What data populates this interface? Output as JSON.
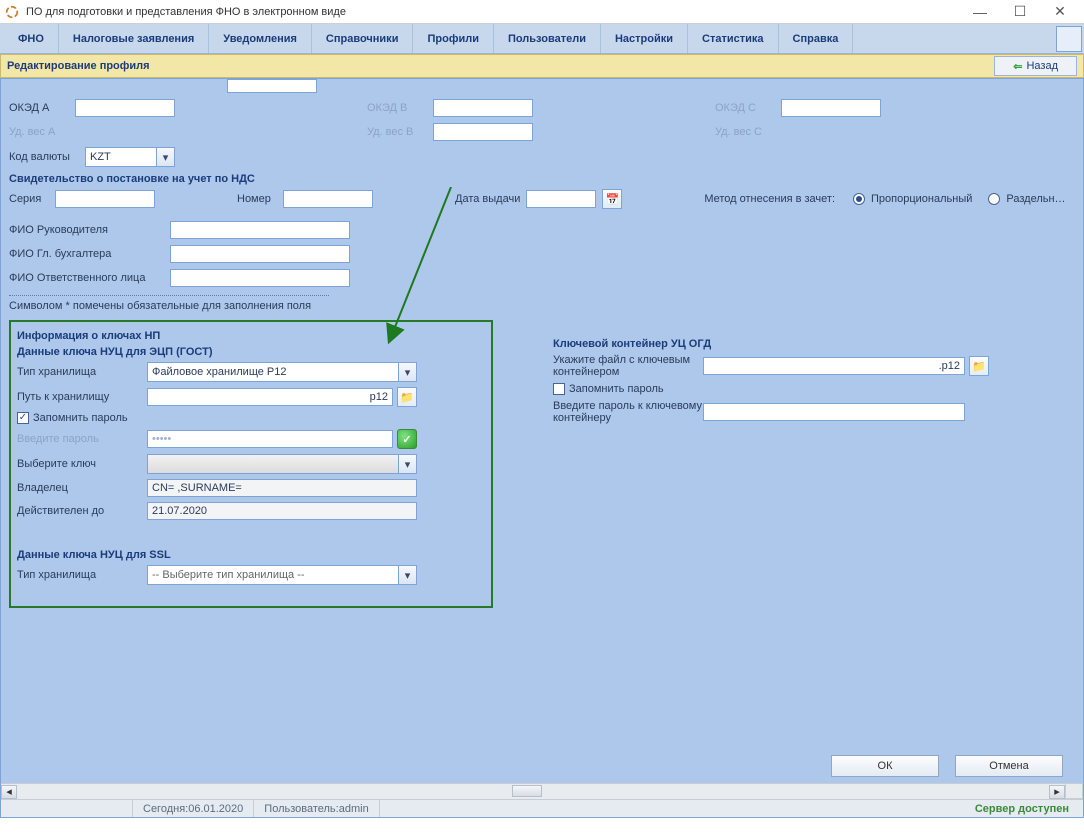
{
  "window": {
    "title": "ПО для подготовки и представления ФНО в электронном виде"
  },
  "menu": {
    "items": [
      "ФНО",
      "Налоговые заявления",
      "Уведомления",
      "Справочники",
      "Профили",
      "Пользователи",
      "Настройки",
      "Статистика",
      "Справка"
    ]
  },
  "subheader": {
    "title": "Редактирование профиля",
    "back_label": "Назад"
  },
  "oked": {
    "a_label": "ОКЭД А",
    "a_value": "",
    "a_weight_label": "Уд. вес А",
    "b_label": "ОКЭД В",
    "b_value": "",
    "b_weight_label": "Уд. вес В",
    "c_label": "ОКЭД С",
    "c_value": "",
    "c_weight_label": "Уд. вес С",
    "currency_label": "Код валюты",
    "currency_value": "KZT"
  },
  "nds": {
    "title": "Свидетельство о постановке на учет по НДС",
    "series_label": "Серия",
    "series_value": "",
    "number_label": "Номер",
    "number_value": "",
    "issue_date_label": "Дата выдачи",
    "method_label": "Метод отнесения в зачет:",
    "opt_proportional": "Пропорциональный",
    "opt_separate": "Раздельн…"
  },
  "fio": {
    "head_label": "ФИО Руководителя",
    "accountant_label": "ФИО Гл. бухгалтера",
    "responsible_label": "ФИО Ответственного лица"
  },
  "required_note": "Символом * помечены обязательные для заполнения поля",
  "np_keys": {
    "title": "Информация о ключах НП",
    "gost_title": "Данные ключа НУЦ для ЭЦП (ГОСТ)",
    "storage_type_label": "Тип хранилища",
    "storage_type_value": "Файловое хранилище P12",
    "path_label": "Путь к хранилищу",
    "path_suffix": "p12",
    "remember_label": "Запомнить пароль",
    "password_label": "Введите пароль",
    "password_mask": "•••••",
    "choose_key_label": "Выберите ключ",
    "owner_label": "Владелец",
    "owner_value": "CN=                          ,SURNAME=",
    "valid_until_label": "Действителен до",
    "valid_until_value": "21.07.2020",
    "ssl_title": "Данные ключа НУЦ для SSL",
    "ssl_storage_type_label": "Тип хранилища",
    "ssl_storage_placeholder": "-- Выберите тип хранилища --"
  },
  "ogd": {
    "title": "Ключевой контейнер УЦ ОГД",
    "file_label": "Укажите файл с ключевым контейнером",
    "file_suffix": ".p12",
    "remember_label": "Запомнить пароль",
    "password_label": "Введите пароль к ключевому контейнеру"
  },
  "buttons": {
    "ok": "ОК",
    "cancel": "Отмена"
  },
  "status": {
    "today_prefix": "Сегодня: ",
    "today_date": "06.01.2020",
    "user_prefix": "Пользователь: ",
    "user": "admin",
    "server": "Сервер доступен"
  }
}
